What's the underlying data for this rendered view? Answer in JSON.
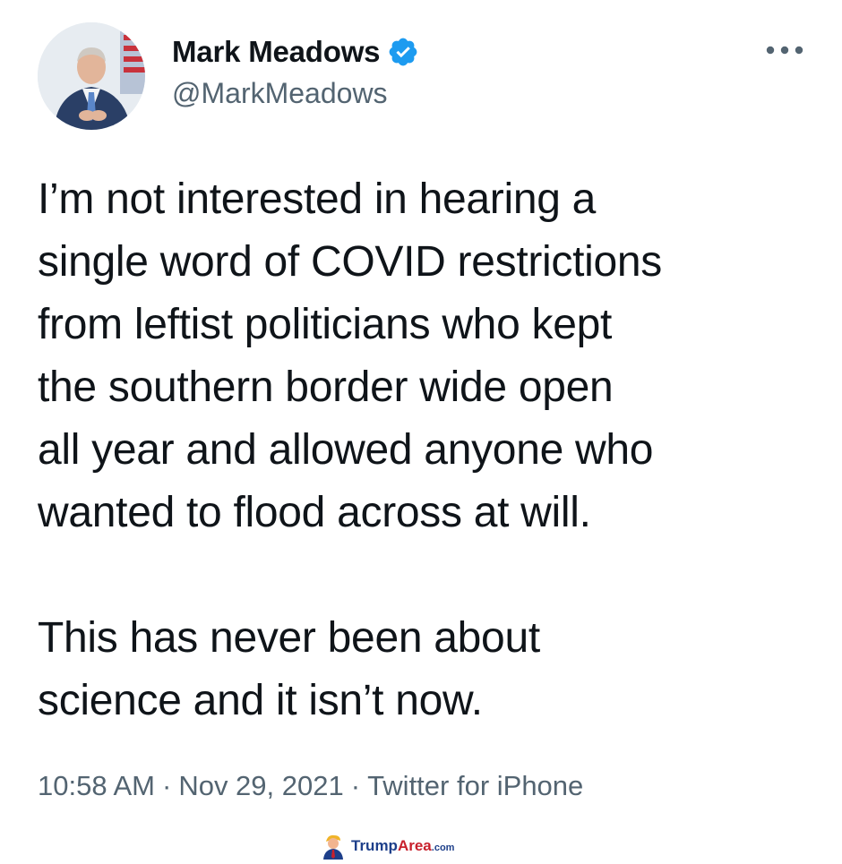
{
  "author": {
    "display_name": "Mark Meadows",
    "handle": "@MarkMeadows",
    "verified": true
  },
  "tweet": {
    "text": "I’m not interested in hearing a\nsingle word of COVID restrictions\nfrom leftist politicians who kept\nthe southern border wide open\nall year and allowed anyone who\nwanted to flood across at will.\n\nThis has never been about\nscience and it isn’t now.",
    "time": "10:58 AM",
    "date": "Nov 29, 2021",
    "source": "Twitter for iPhone",
    "separator": "·"
  },
  "watermark": {
    "brand_main": "Trump",
    "brand_accent": "Area",
    "brand_suffix": ".com"
  },
  "icons": {
    "verified": "verified-badge-icon",
    "more": "more-options-icon",
    "avatar": "profile-avatar"
  },
  "colors": {
    "text": "#0f1419",
    "secondary": "#536471",
    "verified": "#1d9bf0"
  }
}
